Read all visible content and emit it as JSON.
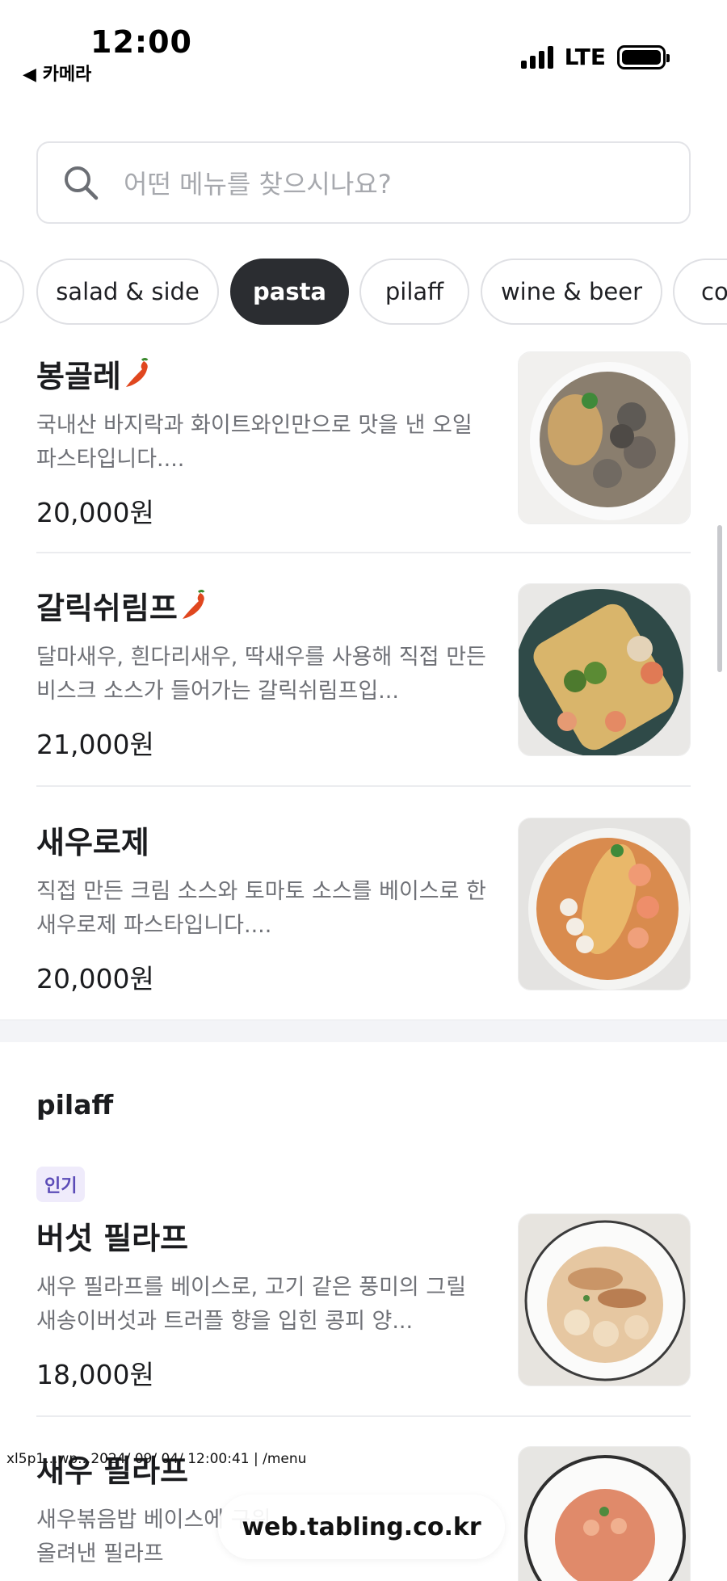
{
  "status": {
    "time": "12:00",
    "back_label": "◀ 카메라",
    "network": "LTE"
  },
  "search": {
    "placeholder": "어떤 메뉴를 찾으시나요?"
  },
  "categories": [
    {
      "label": "salad & side"
    },
    {
      "label": "pasta",
      "active": true
    },
    {
      "label": "pilaff"
    },
    {
      "label": "wine & beer"
    },
    {
      "label": "co"
    }
  ],
  "pasta_items": [
    {
      "name": "봉골레",
      "spicy": true,
      "description": "국내산 바지락과 화이트와인만으로 맛을 낸 오일 파스타입니다....",
      "price": "20,000원"
    },
    {
      "name": "갈릭쉬림프",
      "spicy": true,
      "description": "달마새우, 흰다리새우, 딱새우를 사용해 직접 만든 비스크 소스가 들어가는 갈릭쉬림프입...",
      "price": "21,000원"
    },
    {
      "name": "새우로제",
      "spicy": false,
      "description": "직접 만든 크림 소스와 토마토 소스를 베이스로 한 새우로제 파스타입니다....",
      "price": "20,000원"
    }
  ],
  "pilaff_section": {
    "title": "pilaff",
    "items": [
      {
        "badge": "인기",
        "name": "버섯 필라프",
        "description": "새우 필라프를 베이스로, 고기 같은 풍미의 그릴 새송이버섯과 트러플 향을 입힌 콩피 양...",
        "price": "18,000원"
      },
      {
        "name": "새우 필라프",
        "description": "새우볶음밥 베이스에 구워 올려낸 필라프"
      }
    ]
  },
  "overlay": {
    "url_stamp": "xl5p1...wp...2024/ 09/ 04/ 12:00:41 | /menu",
    "toast": "web.tabling.co.kr"
  },
  "colors": {
    "active_chip": "#2b2d31",
    "badge_bg": "#efebfb",
    "badge_text": "#5b4bb7",
    "spicy": "#e0471f"
  }
}
